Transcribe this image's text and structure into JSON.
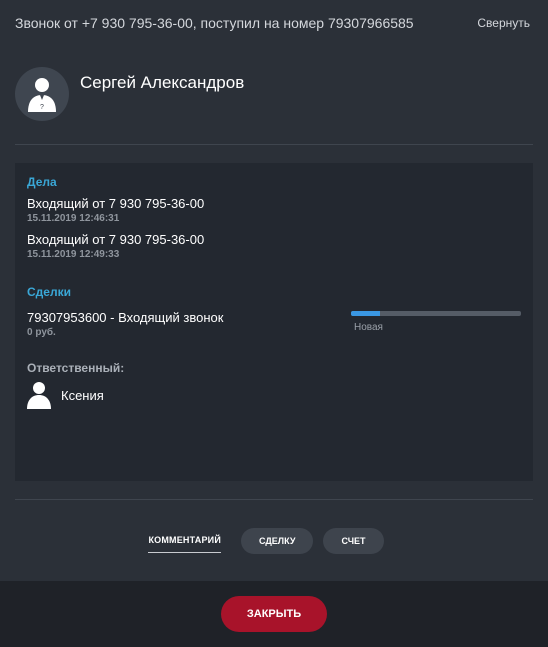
{
  "header": {
    "title": "Звонок от +7 930 795-36-00, поступил на номер 79307966585",
    "collapse_label": "Свернуть"
  },
  "contact": {
    "name": "Сергей Александров",
    "avatar_icon": "user-unknown-icon"
  },
  "tasks": {
    "title": "Дела",
    "items": [
      {
        "title": "Входящий от 7 930 795-36-00",
        "date": "15.11.2019 12:46:31"
      },
      {
        "title": "Входящий от 7 930 795-36-00",
        "date": "15.11.2019 12:49:33"
      }
    ]
  },
  "deals": {
    "title": "Сделки",
    "items": [
      {
        "title": "79307953600 - Входящий звонок",
        "amount": "0 руб.",
        "stage": "Новая",
        "progress": 0.17
      }
    ]
  },
  "responsible": {
    "title": "Ответственный:",
    "name": "Ксения",
    "icon": "user-icon"
  },
  "actions": {
    "comment_label": "КОММЕНТАРИЙ",
    "deal_label": "СДЕЛКУ",
    "invoice_label": "СЧЕТ"
  },
  "footer": {
    "close_label": "ЗАКРЫТЬ"
  },
  "colors": {
    "background": "#2b3038",
    "panel": "#232830",
    "accent": "#3aa7d6",
    "progress": "#3a97e3",
    "close_button": "#a8132a"
  }
}
